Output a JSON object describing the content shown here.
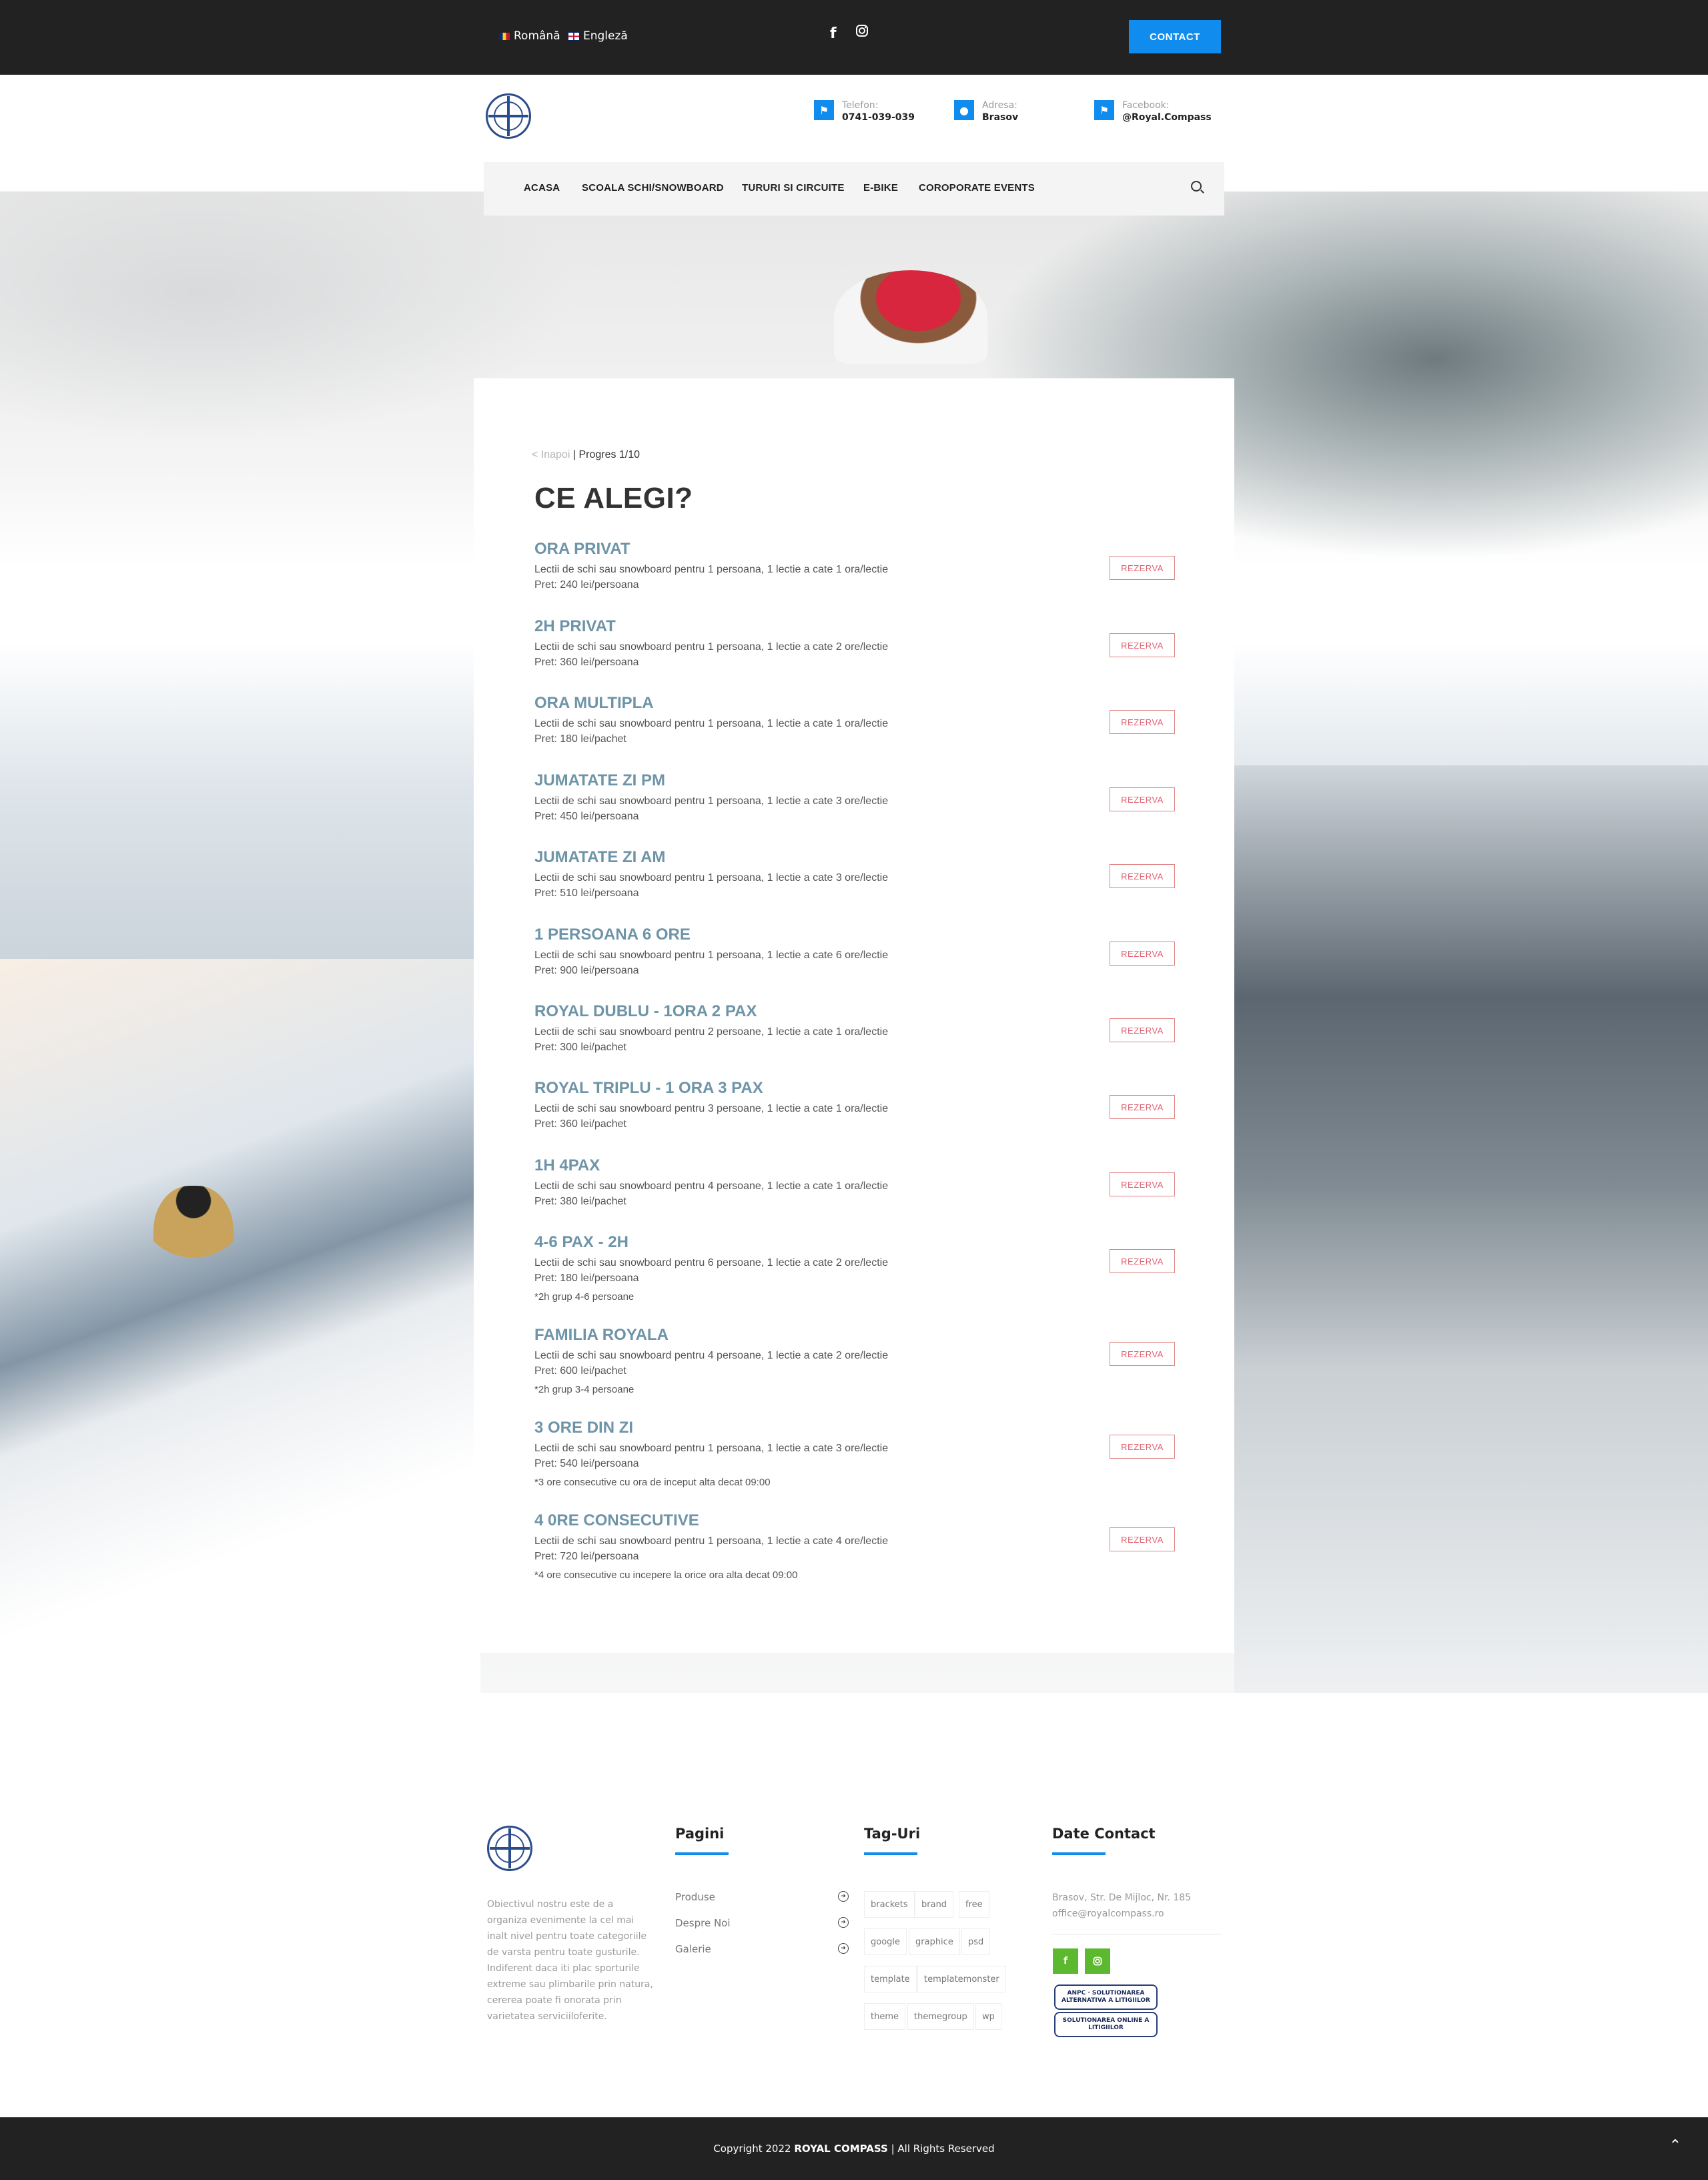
{
  "topbar": {
    "lang_ro": "Română",
    "lang_en": "Engleză",
    "contact_label": "CONTACT",
    "accent_color": "#0f8ced"
  },
  "header": {
    "phone_label": "Telefon:",
    "phone_value": "0741-039-039",
    "address_label": "Adresa:",
    "address_value": "Brasov",
    "facebook_label": "Facebook:",
    "facebook_value": "@Royal.Compass"
  },
  "nav": {
    "items": [
      "ACASA",
      "SCOALA SCHI/SNOWBOARD",
      "TURURI SI CIRCUITE",
      "E-BIKE",
      "COROPORATE EVENTS"
    ]
  },
  "booking": {
    "back_label": "< Inapoi",
    "separator": " | ",
    "progress": "Progres 1/10",
    "title": "CE ALEGI?",
    "reserve_label": "REZERVA",
    "options": [
      {
        "title": "ORA PRIVAT",
        "desc": "Lectii de schi sau snowboard pentru 1 persoana, 1 lectie a cate 1 ora/lectie",
        "price": "Pret: 240 lei/persoana",
        "note": ""
      },
      {
        "title": "2H PRIVAT",
        "desc": "Lectii de schi sau snowboard pentru 1 persoana, 1 lectie a cate 2 ore/lectie",
        "price": "Pret: 360 lei/persoana",
        "note": ""
      },
      {
        "title": "ORA MULTIPLA",
        "desc": "Lectii de schi sau snowboard pentru 1 persoana, 1 lectie a cate 1 ora/lectie",
        "price": "Pret: 180 lei/pachet",
        "note": ""
      },
      {
        "title": "JUMATATE ZI PM",
        "desc": "Lectii de schi sau snowboard pentru 1 persoana, 1 lectie a cate 3 ore/lectie",
        "price": "Pret: 450 lei/persoana",
        "note": ""
      },
      {
        "title": "JUMATATE ZI AM",
        "desc": "Lectii de schi sau snowboard pentru 1 persoana, 1 lectie a cate 3 ore/lectie",
        "price": "Pret: 510 lei/persoana",
        "note": ""
      },
      {
        "title": "1 PERSOANA 6 ORE",
        "desc": "Lectii de schi sau snowboard pentru 1 persoana, 1 lectie a cate 6 ore/lectie",
        "price": "Pret: 900 lei/persoana",
        "note": ""
      },
      {
        "title": "ROYAL DUBLU - 1ORA 2 PAX",
        "desc": "Lectii de schi sau snowboard pentru 2 persoane, 1 lectie a cate 1 ora/lectie",
        "price": "Pret: 300 lei/pachet",
        "note": ""
      },
      {
        "title": "ROYAL TRIPLU - 1 ORA 3 PAX",
        "desc": "Lectii de schi sau snowboard pentru 3 persoane, 1 lectie a cate 1 ora/lectie",
        "price": "Pret: 360 lei/pachet",
        "note": ""
      },
      {
        "title": "1H 4PAX",
        "desc": "Lectii de schi sau snowboard pentru 4 persoane, 1 lectie a cate 1 ora/lectie",
        "price": "Pret: 380 lei/pachet",
        "note": ""
      },
      {
        "title": "4-6 PAX - 2H",
        "desc": "Lectii de schi sau snowboard pentru 6 persoane, 1 lectie a cate 2 ore/lectie",
        "price": "Pret: 180 lei/persoana",
        "note": "*2h grup 4-6 persoane"
      },
      {
        "title": "FAMILIA ROYALA",
        "desc": "Lectii de schi sau snowboard pentru 4 persoane, 1 lectie a cate 2 ore/lectie",
        "price": "Pret: 600 lei/pachet",
        "note": "*2h grup 3-4 persoane"
      },
      {
        "title": "3 ORE DIN ZI",
        "desc": "Lectii de schi sau snowboard pentru 1 persoana, 1 lectie a cate 3 ore/lectie",
        "price": "Pret: 540 lei/persoana",
        "note": "*3 ore consecutive cu ora de inceput alta decat 09:00"
      },
      {
        "title": "4 0RE CONSECUTIVE",
        "desc": "Lectii de schi sau snowboard pentru 1 persoana, 1 lectie a cate 4 ore/lectie",
        "price": "Pret: 720 lei/persoana",
        "note": "*4 ore consecutive cu incepere la orice ora alta decat 09:00"
      }
    ]
  },
  "footer": {
    "about": "Obiectivul nostru este de a organiza evenimente la cel mai inalt nivel pentru toate categoriile de varsta pentru toate gusturile. Indiferent daca iti plac sporturile extreme sau plimbarile prin natura, cererea poate fi onorata prin varietatea serviciiloferite.",
    "pages_title": "Pagini",
    "pages": [
      "Produse",
      "Despre Noi",
      "Galerie"
    ],
    "tags_title": "Tag-Uri",
    "tags": [
      "brackets",
      "brand",
      "free",
      "google",
      "graphice",
      "psd",
      "template",
      "templatemonster",
      "theme",
      "themegroup",
      "wp"
    ],
    "contact_title": "Date Contact",
    "address": "Brasov, Str. De Mijloc, Nr. 185",
    "email": "office@royalcompass.ro",
    "badge1": "ANPC · SOLUTIONAREA ALTERNATIVA A LITIGIILOR",
    "badge2": "SOLUTIONAREA ONLINE A LITIGIILOR",
    "social_color": "#5cb82e",
    "copyright_pre": "Copyright 2022",
    "brand": "ROYAL COMPASS",
    "copyright_post": "| All Rights Reserved"
  }
}
